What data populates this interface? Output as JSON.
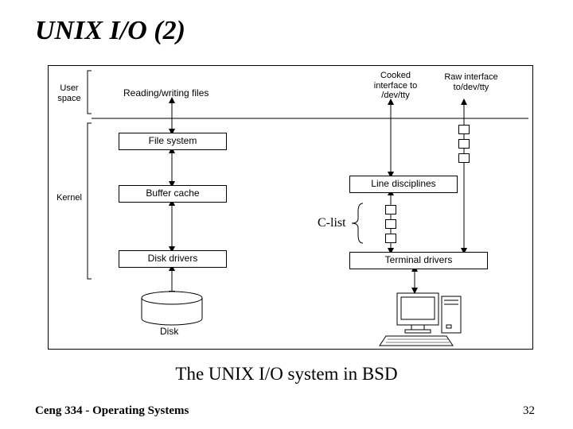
{
  "slide": {
    "title": "UNIX  I/O (2)",
    "caption": "The UNIX I/O system in BSD",
    "footer": "Ceng 334 - Operating Systems",
    "page_number": "32"
  },
  "diagram": {
    "layer_labels": {
      "user_space": "User\nspace",
      "kernel": "Kernel"
    },
    "top_labels": {
      "reading_writing": "Reading/writing files",
      "cooked": "Cooked\ninterface to\n/dev/tty",
      "raw": "Raw interface\nto/dev/tty"
    },
    "boxes": {
      "file_system": "File system",
      "buffer_cache": "Buffer cache",
      "disk_drivers": "Disk drivers",
      "line_disciplines": "Line disciplines",
      "terminal_drivers": "Terminal drivers"
    },
    "annotations": {
      "clist": "C-list",
      "disk": "Disk"
    }
  }
}
